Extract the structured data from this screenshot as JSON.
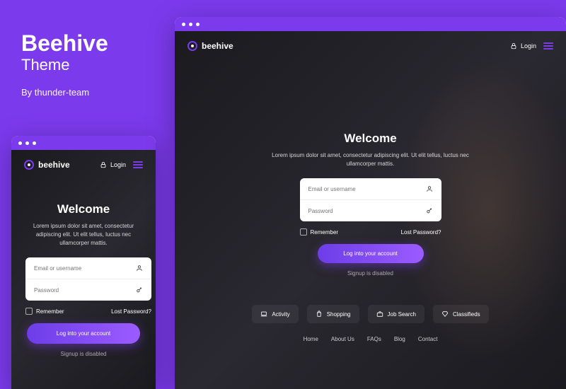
{
  "promo": {
    "title": "Beehive",
    "subtitle": "Theme",
    "byline": "By thunder-team"
  },
  "brand": "beehive",
  "header": {
    "login_label": "Login"
  },
  "hero": {
    "title": "Welcome",
    "description": "Lorem ipsum dolor sit amet, consectetur adipiscing elit. Ut elit tellus, luctus nec ullamcorper mattis."
  },
  "form": {
    "email_placeholder": "Email or username",
    "password_placeholder": "Password",
    "remember_label": "Remember",
    "lost_password_label": "Lost Password?",
    "submit_label": "Log into your account",
    "signup_disabled": "Signup is disabled"
  },
  "categories": [
    {
      "icon": "laptop",
      "label": "Activity"
    },
    {
      "icon": "bag",
      "label": "Shopping"
    },
    {
      "icon": "briefcase",
      "label": "Job Search"
    },
    {
      "icon": "diamond",
      "label": "Classifieds"
    }
  ],
  "footer_nav": [
    "Home",
    "About Us",
    "FAQs",
    "Blog",
    "Contact"
  ]
}
